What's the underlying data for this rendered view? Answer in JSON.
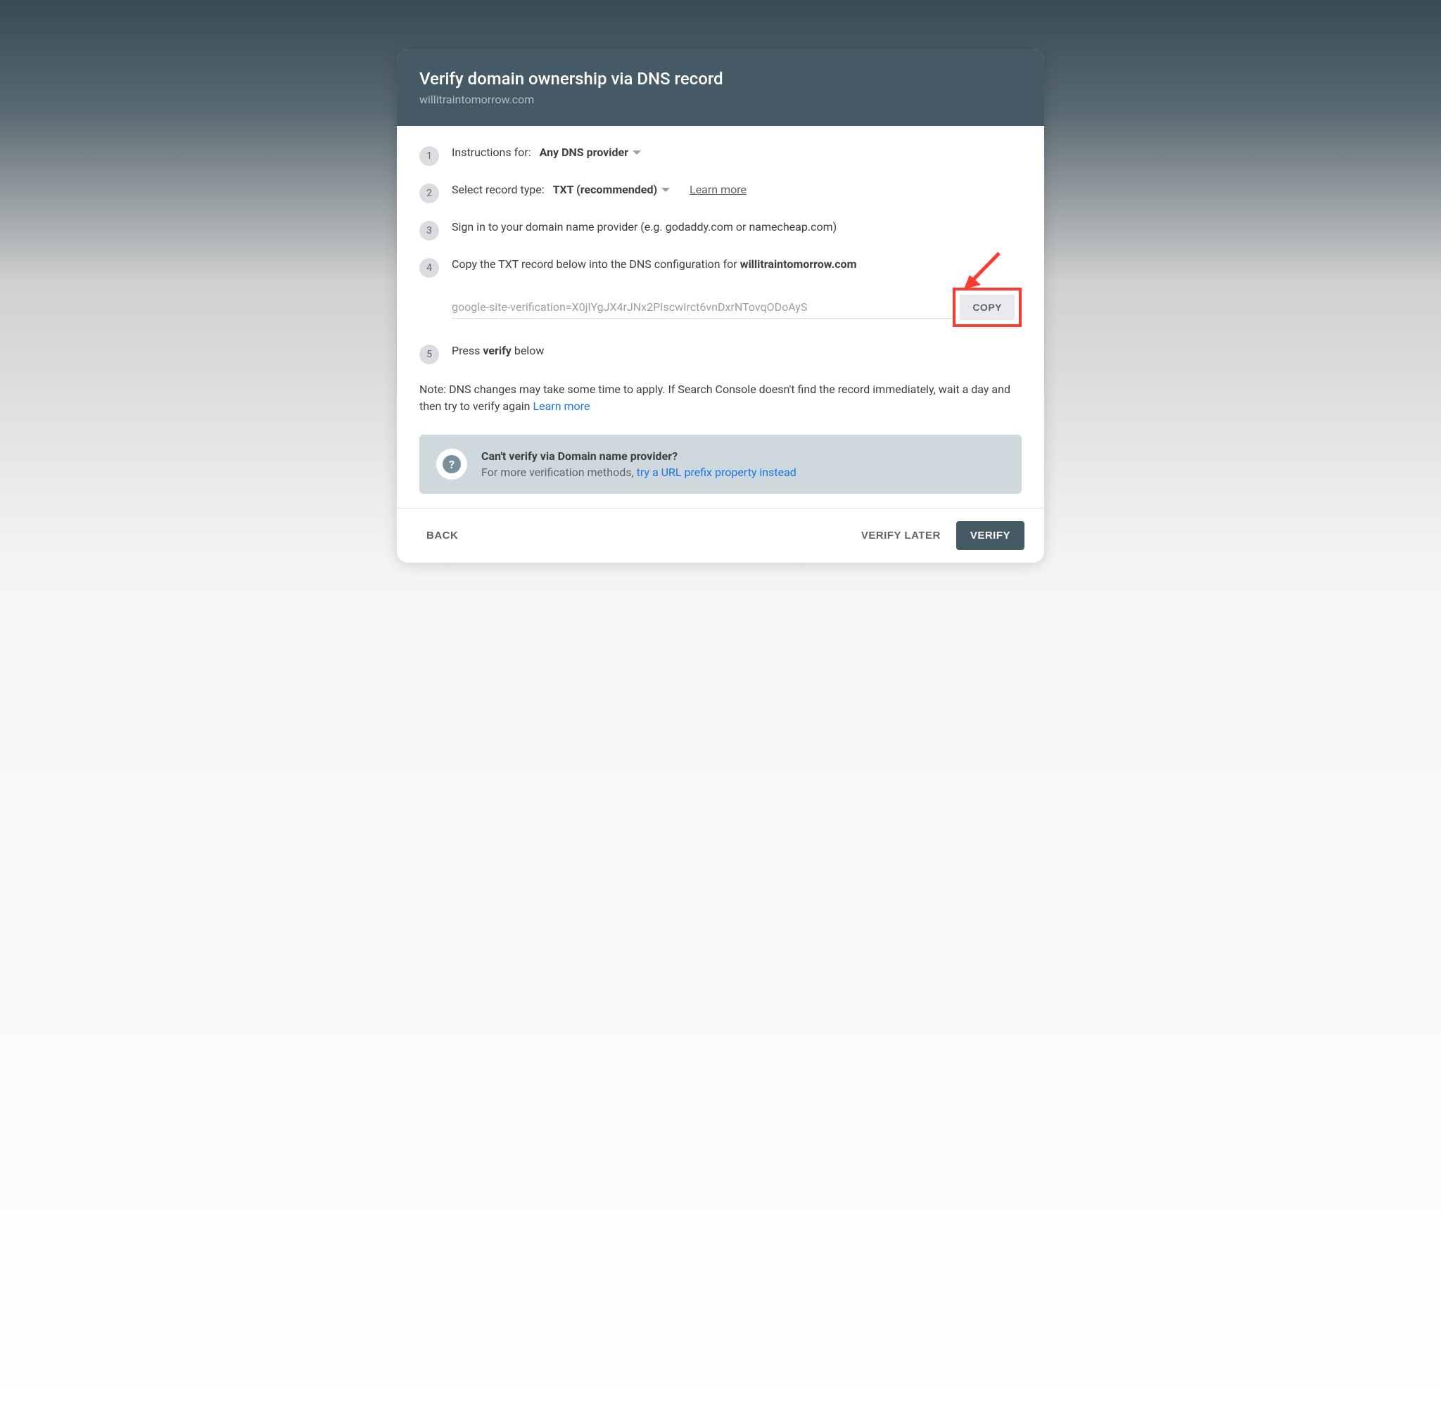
{
  "header": {
    "title": "Verify domain ownership via DNS record",
    "subtitle": "willitraintomorrow.com"
  },
  "steps": {
    "s1": {
      "num": "1",
      "label": "Instructions for:",
      "value": "Any DNS provider"
    },
    "s2": {
      "num": "2",
      "label": "Select record type:",
      "value": "TXT (recommended)",
      "learn": "Learn more"
    },
    "s3": {
      "num": "3",
      "text": "Sign in to your domain name provider (e.g. godaddy.com or namecheap.com)"
    },
    "s4": {
      "num": "4",
      "prefix": "Copy the TXT record below into the DNS configuration for ",
      "domain": "willitraintomorrow.com",
      "txt_value": "google-site-verification=X0jIYgJX4rJNx2PIscwIrct6vnDxrNTovqODoAyS",
      "copy": "COPY"
    },
    "s5": {
      "num": "5",
      "prefix": "Press ",
      "verify_word": "verify",
      "suffix": " below"
    }
  },
  "note": {
    "text": "Note: DNS changes may take some time to apply. If Search Console doesn't find the record immediately, wait a day and then try to verify again ",
    "link": "Learn more"
  },
  "alt": {
    "title": "Can't verify via Domain name provider?",
    "sub_prefix": "For more verification methods, ",
    "link": "try a URL prefix property instead",
    "help_glyph": "?"
  },
  "footer": {
    "back": "BACK",
    "later": "VERIFY LATER",
    "verify": "VERIFY"
  }
}
